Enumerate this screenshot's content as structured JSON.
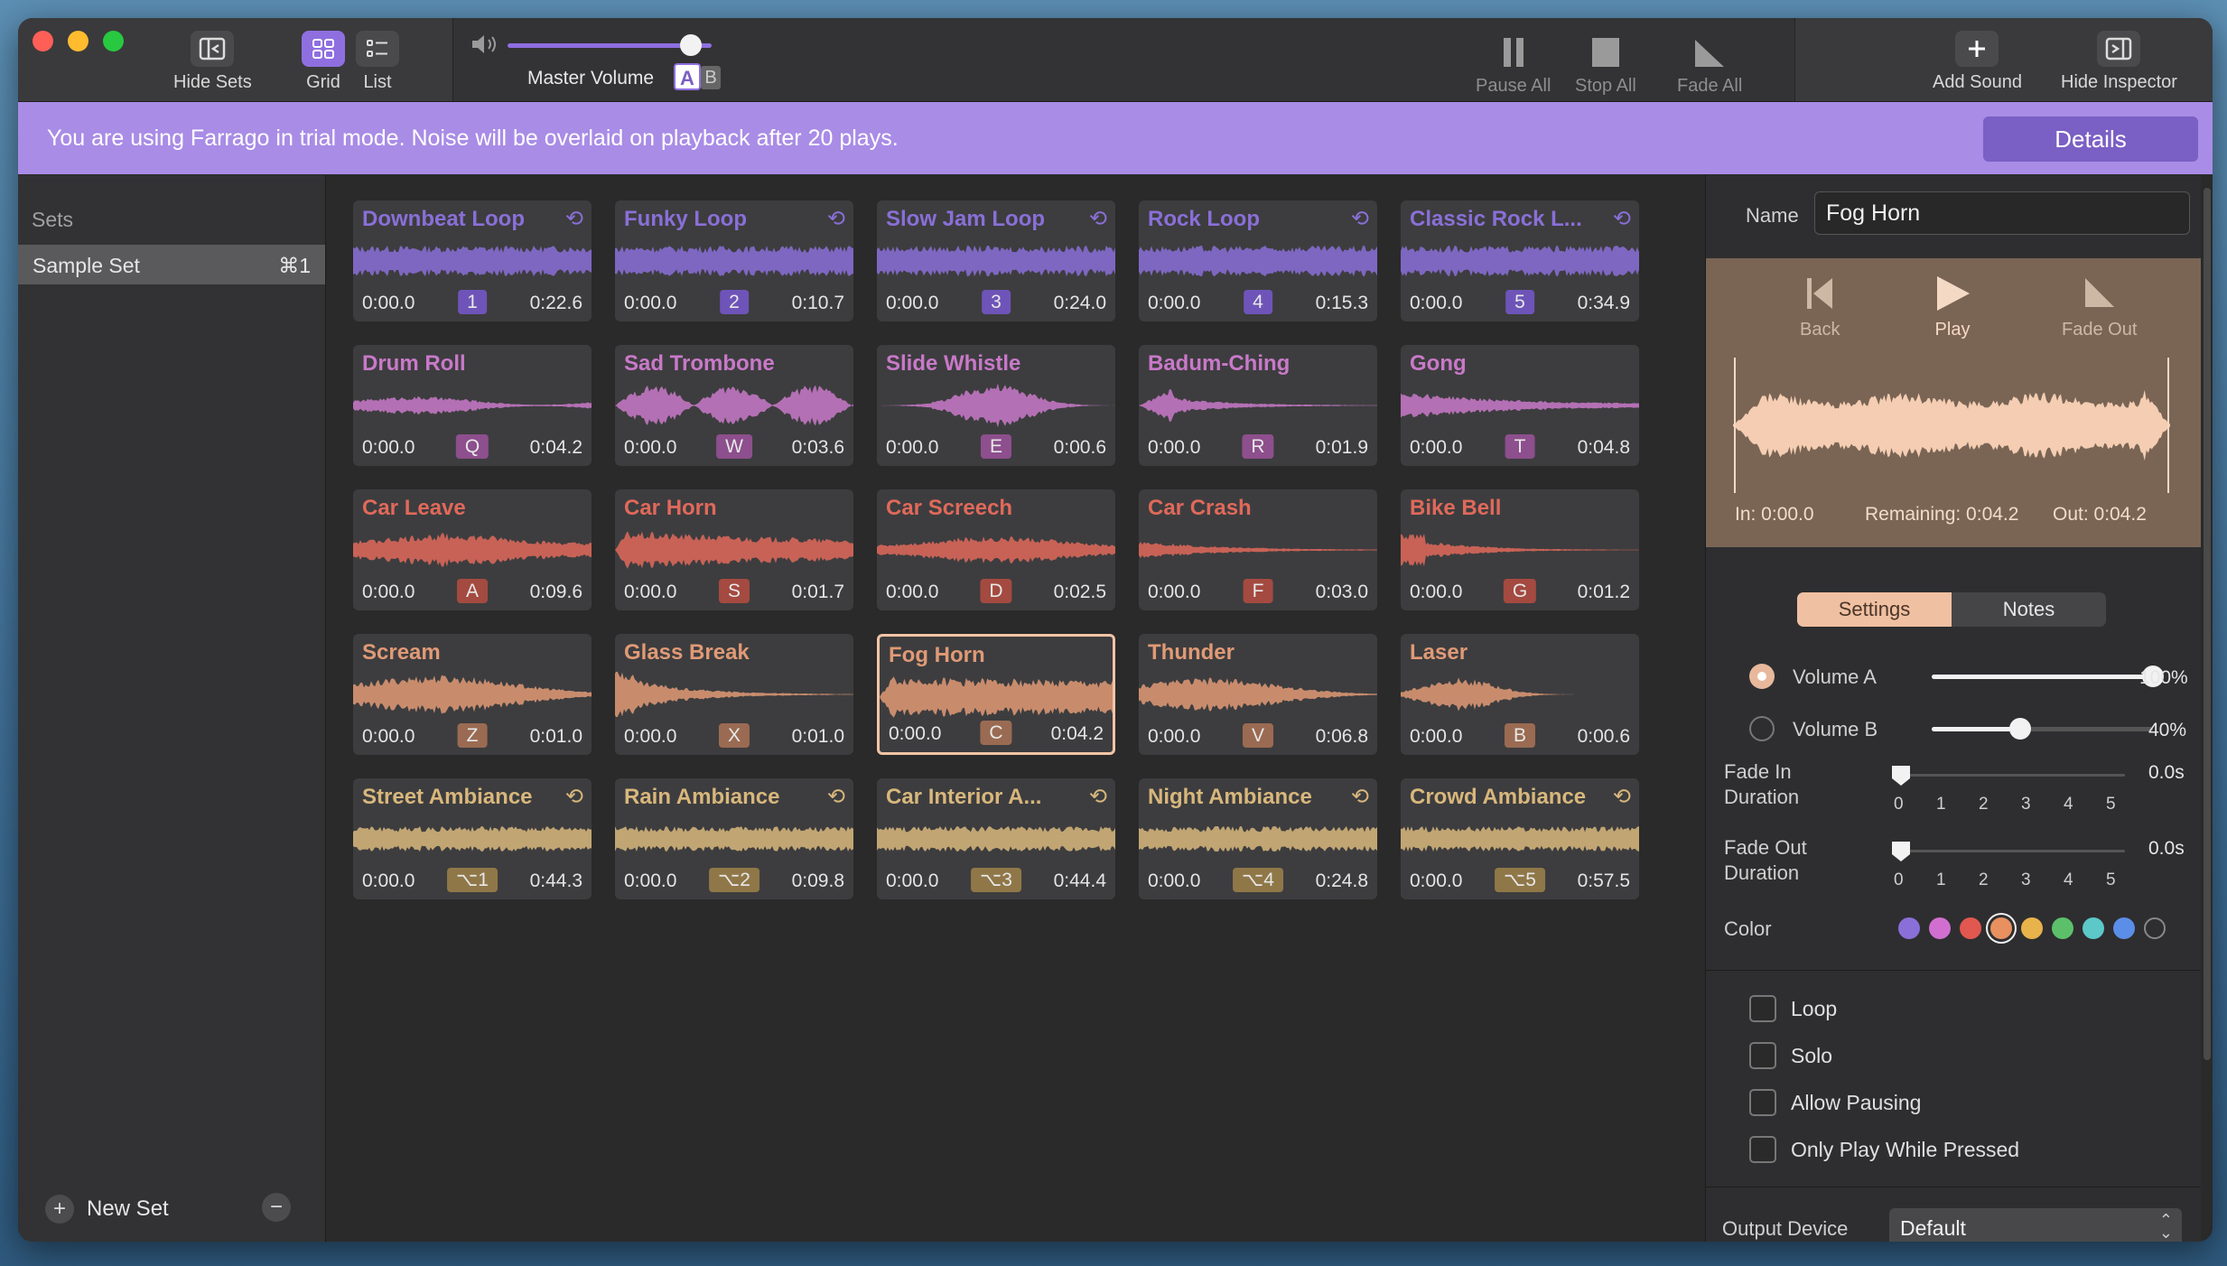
{
  "toolbar": {
    "hide_sets": "Hide Sets",
    "grid": "Grid",
    "list": "List",
    "master_volume": "Master Volume",
    "master_level": 0.9,
    "ab_a": "A",
    "ab_b": "B",
    "pause_all": "Pause All",
    "stop_all": "Stop All",
    "fade_all": "Fade All",
    "add_sound": "Add Sound",
    "hide_inspector": "Hide Inspector"
  },
  "trial": {
    "message": "You are using Farrago in trial mode. Noise will be overlaid on playback after 20 plays.",
    "details": "Details"
  },
  "sidebar": {
    "heading": "Sets",
    "sets": [
      {
        "name": "Sample Set",
        "shortcut": "⌘1"
      }
    ],
    "new_set": "New Set"
  },
  "tiles": [
    {
      "name": "Downbeat Loop",
      "start": "0:00.0",
      "key": "1",
      "end": "0:22.6",
      "loop": true,
      "color": "#8a6fd8",
      "keybg": "#6e54b8"
    },
    {
      "name": "Funky Loop",
      "start": "0:00.0",
      "key": "2",
      "end": "0:10.7",
      "loop": true,
      "color": "#8a6fd8",
      "keybg": "#6e54b8"
    },
    {
      "name": "Slow Jam Loop",
      "start": "0:00.0",
      "key": "3",
      "end": "0:24.0",
      "loop": true,
      "color": "#8a6fd8",
      "keybg": "#6e54b8"
    },
    {
      "name": "Rock Loop",
      "start": "0:00.0",
      "key": "4",
      "end": "0:15.3",
      "loop": true,
      "color": "#8a6fd8",
      "keybg": "#6e54b8"
    },
    {
      "name": "Classic Rock L...",
      "start": "0:00.0",
      "key": "5",
      "end": "0:34.9",
      "loop": true,
      "color": "#8a6fd8",
      "keybg": "#6e54b8"
    },
    {
      "name": "Drum Roll",
      "start": "0:00.0",
      "key": "Q",
      "end": "0:04.2",
      "loop": false,
      "color": "#c979c9",
      "keybg": "#8d4f8d"
    },
    {
      "name": "Sad Trombone",
      "start": "0:00.0",
      "key": "W",
      "end": "0:03.6",
      "loop": false,
      "color": "#c979c9",
      "keybg": "#8d4f8d"
    },
    {
      "name": "Slide Whistle",
      "start": "0:00.0",
      "key": "E",
      "end": "0:00.6",
      "loop": false,
      "color": "#c979c9",
      "keybg": "#8d4f8d"
    },
    {
      "name": "Badum-Ching",
      "start": "0:00.0",
      "key": "R",
      "end": "0:01.9",
      "loop": false,
      "color": "#c979c9",
      "keybg": "#8d4f8d"
    },
    {
      "name": "Gong",
      "start": "0:00.0",
      "key": "T",
      "end": "0:04.8",
      "loop": false,
      "color": "#c979c9",
      "keybg": "#8d4f8d"
    },
    {
      "name": "Car Leave",
      "start": "0:00.0",
      "key": "A",
      "end": "0:09.6",
      "loop": false,
      "color": "#e0695a",
      "keybg": "#a44a40"
    },
    {
      "name": "Car Horn",
      "start": "0:00.0",
      "key": "S",
      "end": "0:01.7",
      "loop": false,
      "color": "#e0695a",
      "keybg": "#a44a40"
    },
    {
      "name": "Car Screech",
      "start": "0:00.0",
      "key": "D",
      "end": "0:02.5",
      "loop": false,
      "color": "#e0695a",
      "keybg": "#a44a40"
    },
    {
      "name": "Car Crash",
      "start": "0:00.0",
      "key": "F",
      "end": "0:03.0",
      "loop": false,
      "color": "#e0695a",
      "keybg": "#a44a40"
    },
    {
      "name": "Bike Bell",
      "start": "0:00.0",
      "key": "G",
      "end": "0:01.2",
      "loop": false,
      "color": "#e0695a",
      "keybg": "#a44a40"
    },
    {
      "name": "Scream",
      "start": "0:00.0",
      "key": "Z",
      "end": "0:01.0",
      "loop": false,
      "color": "#e09a76",
      "keybg": "#9a6b52"
    },
    {
      "name": "Glass Break",
      "start": "0:00.0",
      "key": "X",
      "end": "0:01.0",
      "loop": false,
      "color": "#e09a76",
      "keybg": "#9a6b52"
    },
    {
      "name": "Fog Horn",
      "start": "0:00.0",
      "key": "C",
      "end": "0:04.2",
      "loop": false,
      "color": "#e09a76",
      "keybg": "#9a6b52",
      "selected": true
    },
    {
      "name": "Thunder",
      "start": "0:00.0",
      "key": "V",
      "end": "0:06.8",
      "loop": false,
      "color": "#e09a76",
      "keybg": "#9a6b52"
    },
    {
      "name": "Laser",
      "start": "0:00.0",
      "key": "B",
      "end": "0:00.6",
      "loop": false,
      "color": "#e09a76",
      "keybg": "#9a6b52"
    },
    {
      "name": "Street Ambiance",
      "start": "0:00.0",
      "key": "⌥1",
      "end": "0:44.3",
      "loop": true,
      "color": "#d8b77c",
      "keybg": "#8f7748"
    },
    {
      "name": "Rain Ambiance",
      "start": "0:00.0",
      "key": "⌥2",
      "end": "0:09.8",
      "loop": true,
      "color": "#d8b77c",
      "keybg": "#8f7748"
    },
    {
      "name": "Car Interior A...",
      "start": "0:00.0",
      "key": "⌥3",
      "end": "0:44.4",
      "loop": true,
      "color": "#d8b77c",
      "keybg": "#8f7748"
    },
    {
      "name": "Night Ambiance",
      "start": "0:00.0",
      "key": "⌥4",
      "end": "0:24.8",
      "loop": true,
      "color": "#d8b77c",
      "keybg": "#8f7748"
    },
    {
      "name": "Crowd Ambiance",
      "start": "0:00.0",
      "key": "⌥5",
      "end": "0:57.5",
      "loop": true,
      "color": "#d8b77c",
      "keybg": "#8f7748"
    }
  ],
  "inspector": {
    "name_label": "Name",
    "name_value": "Fog Horn",
    "back": "Back",
    "play": "Play",
    "fade_out": "Fade Out",
    "in_time": "In: 0:00.0",
    "remaining": "Remaining: 0:04.2",
    "out_time": "Out: 0:04.2",
    "tab_settings": "Settings",
    "tab_notes": "Notes",
    "volume_a_label": "Volume A",
    "volume_a_value": "100%",
    "volume_a_level": 1.0,
    "volume_b_label": "Volume B",
    "volume_b_value": "40%",
    "volume_b_level": 0.4,
    "fade_in_label_1": "Fade In",
    "fade_in_label_2": "Duration",
    "fade_in_value": "0.0s",
    "fade_out_label_1": "Fade Out",
    "fade_out_label_2": "Duration",
    "fade_out_value": "0.0s",
    "ticks": [
      "0",
      "1",
      "2",
      "3",
      "4",
      "5"
    ],
    "color_label": "Color",
    "colors": [
      "#8a6fd8",
      "#d06fd0",
      "#e0584f",
      "#e89060",
      "#e8b34a",
      "#5cc06a",
      "#5cc8c8",
      "#5b8ee8",
      "none"
    ],
    "selected_color": "#e89060",
    "loop": "Loop",
    "solo": "Solo",
    "allow_pausing": "Allow Pausing",
    "only_play": "Only Play While Pressed",
    "output_label": "Output Device",
    "output_value": "Default",
    "wave_color": "#f4cdb2"
  }
}
